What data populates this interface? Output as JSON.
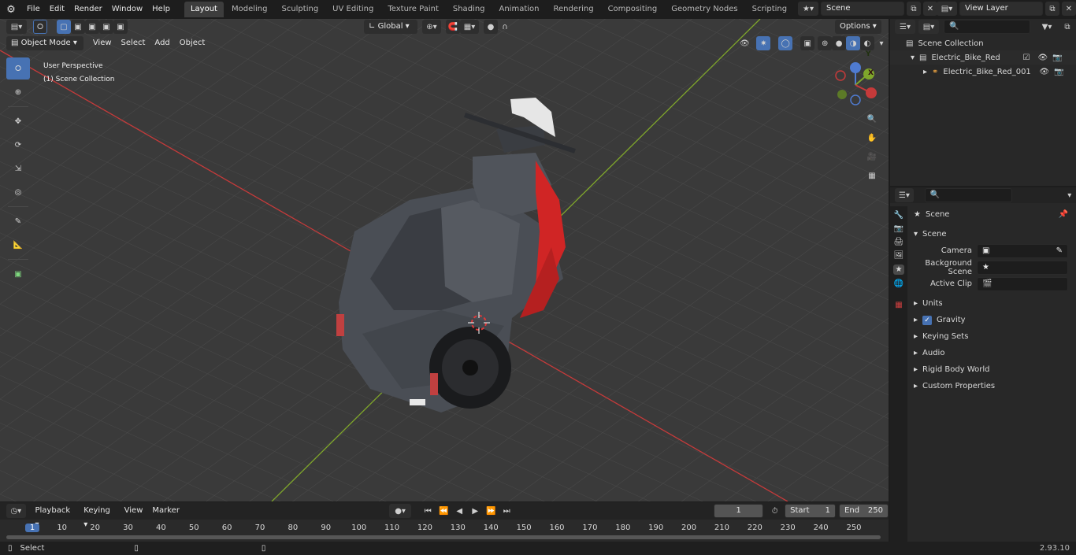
{
  "topbar": {
    "menus": [
      "File",
      "Edit",
      "Render",
      "Window",
      "Help"
    ],
    "workspaces": [
      "Layout",
      "Modeling",
      "Sculpting",
      "UV Editing",
      "Texture Paint",
      "Shading",
      "Animation",
      "Rendering",
      "Compositing",
      "Geometry Nodes",
      "Scripting"
    ],
    "active_workspace": "Layout",
    "add_tab": "+",
    "scene_name": "Scene",
    "view_layer": "View Layer"
  },
  "viewport_header": {
    "transform_orientation": "Global",
    "options_label": "Options",
    "mode": "Object Mode",
    "menus": [
      "View",
      "Select",
      "Add",
      "Object"
    ]
  },
  "viewport": {
    "perspective_label": "User Perspective",
    "collection_label": "(1) Scene Collection",
    "gizmo": {
      "x": "X",
      "y": "Y",
      "z": "Z"
    }
  },
  "outliner": {
    "root": "Scene Collection",
    "items": [
      {
        "label": "Electric_Bike_Red",
        "depth": 1
      },
      {
        "label": "Electric_Bike_Red_001",
        "depth": 2
      }
    ]
  },
  "properties": {
    "context": "Scene",
    "panel_title": "Scene",
    "fields": [
      {
        "label": "Camera",
        "value": ""
      },
      {
        "label": "Background Scene",
        "value": ""
      },
      {
        "label": "Active Clip",
        "value": ""
      }
    ],
    "subpanels": [
      "Units",
      "Gravity",
      "Keying Sets",
      "Audio",
      "Rigid Body World",
      "Custom Properties"
    ],
    "gravity_checked": true
  },
  "timeline": {
    "menus": [
      "Playback",
      "Keying",
      "View",
      "Marker"
    ],
    "current_frame": "1",
    "start_label": "Start",
    "start_value": "1",
    "end_label": "End",
    "end_value": "250",
    "ruler": [
      "1",
      "10",
      "20",
      "30",
      "40",
      "50",
      "60",
      "70",
      "80",
      "90",
      "100",
      "110",
      "120",
      "130",
      "140",
      "150",
      "160",
      "170",
      "180",
      "190",
      "200",
      "210",
      "220",
      "230",
      "240",
      "250"
    ]
  },
  "statusbar": {
    "left": "Select",
    "version": "2.93.10"
  },
  "colors": {
    "accent": "#4772b3",
    "x_axis": "#c63a3a",
    "y_axis": "#7fa62b",
    "bike_red": "#d02525"
  }
}
